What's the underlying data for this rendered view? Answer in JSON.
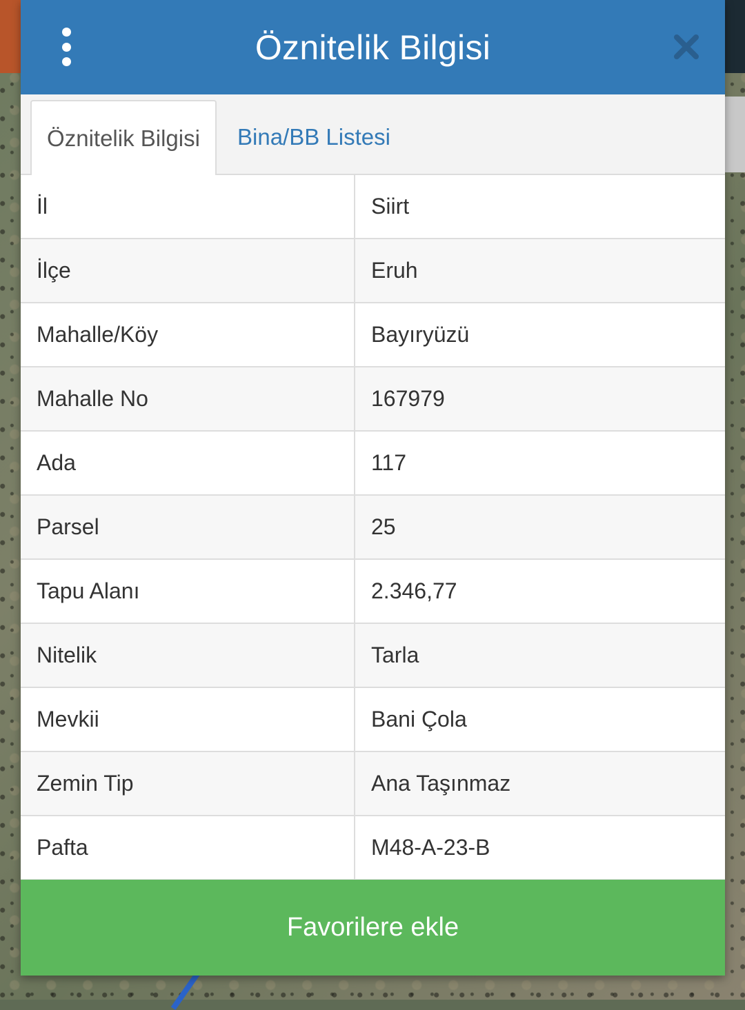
{
  "header": {
    "title": "Öznitelik Bilgisi",
    "menu_icon": "more-vertical-icon",
    "close_icon": "close-icon"
  },
  "tabs": [
    {
      "label": "Öznitelik Bilgisi",
      "active": true
    },
    {
      "label": "Bina/BB Listesi",
      "active": false
    }
  ],
  "attributes": [
    {
      "key": "İl",
      "value": "Siirt"
    },
    {
      "key": "İlçe",
      "value": "Eruh"
    },
    {
      "key": "Mahalle/Köy",
      "value": "Bayıryüzü"
    },
    {
      "key": "Mahalle No",
      "value": "167979"
    },
    {
      "key": "Ada",
      "value": "117"
    },
    {
      "key": "Parsel",
      "value": "25"
    },
    {
      "key": "Tapu Alanı",
      "value": "2.346,77"
    },
    {
      "key": "Nitelik",
      "value": "Tarla"
    },
    {
      "key": "Mevkii",
      "value": "Bani Çola"
    },
    {
      "key": "Zemin Tip",
      "value": "Ana Taşınmaz"
    },
    {
      "key": "Pafta",
      "value": "M48-A-23-B"
    }
  ],
  "footer": {
    "favorite_label": "Favorilere ekle"
  },
  "colors": {
    "header": "#337ab7",
    "tab_link": "#337ab7",
    "favorite_button": "#5cb85c"
  }
}
